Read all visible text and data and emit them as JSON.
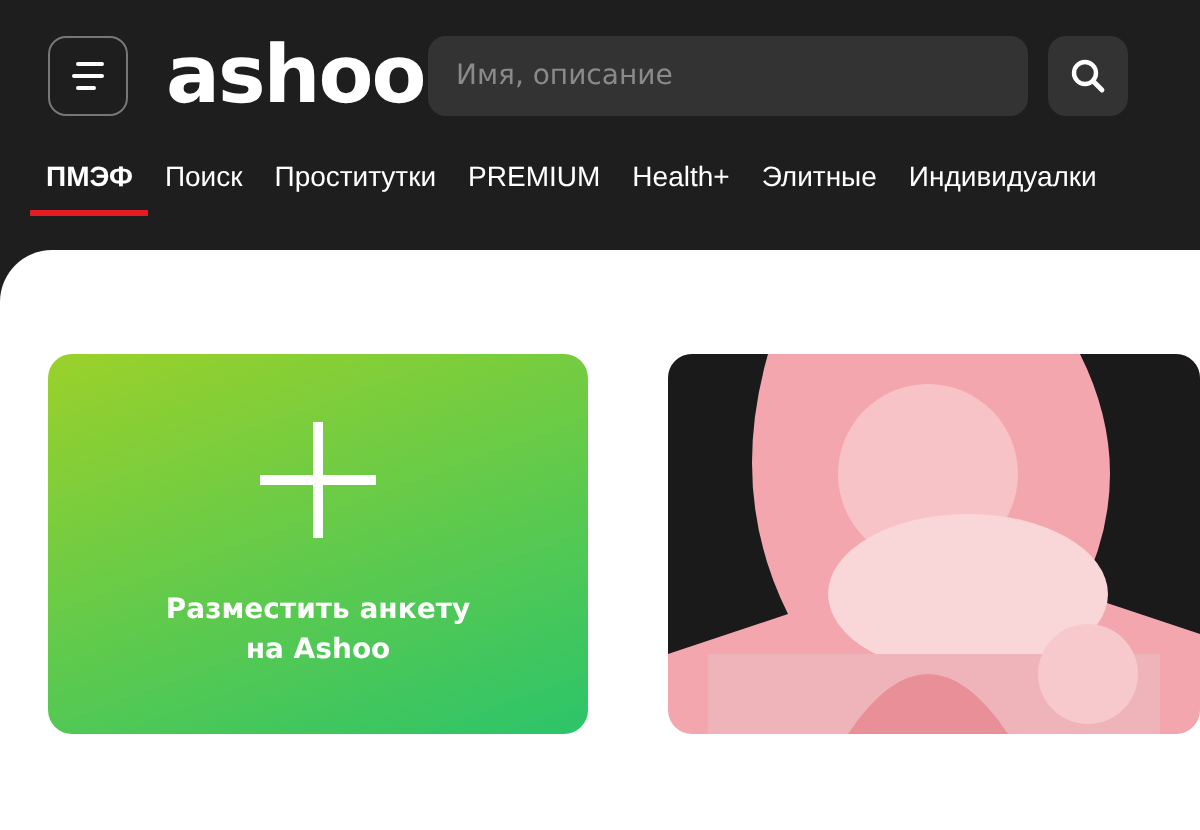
{
  "header": {
    "logo": "ashoo",
    "search": {
      "placeholder": "Имя, описание"
    }
  },
  "nav": [
    {
      "label": "ПМЭФ",
      "selected": true
    },
    {
      "label": "Поиск",
      "selected": false
    },
    {
      "label": "Проститутки",
      "selected": false
    },
    {
      "label": "PREMIUM",
      "selected": false
    },
    {
      "label": "Health+",
      "selected": false
    },
    {
      "label": "Элитные",
      "selected": false
    },
    {
      "label": "Индивидуалки",
      "selected": false
    }
  ],
  "cards": [
    {
      "kind": "add",
      "text": "Разместить анкету на Ashoo"
    },
    {
      "kind": "picture"
    }
  ]
}
